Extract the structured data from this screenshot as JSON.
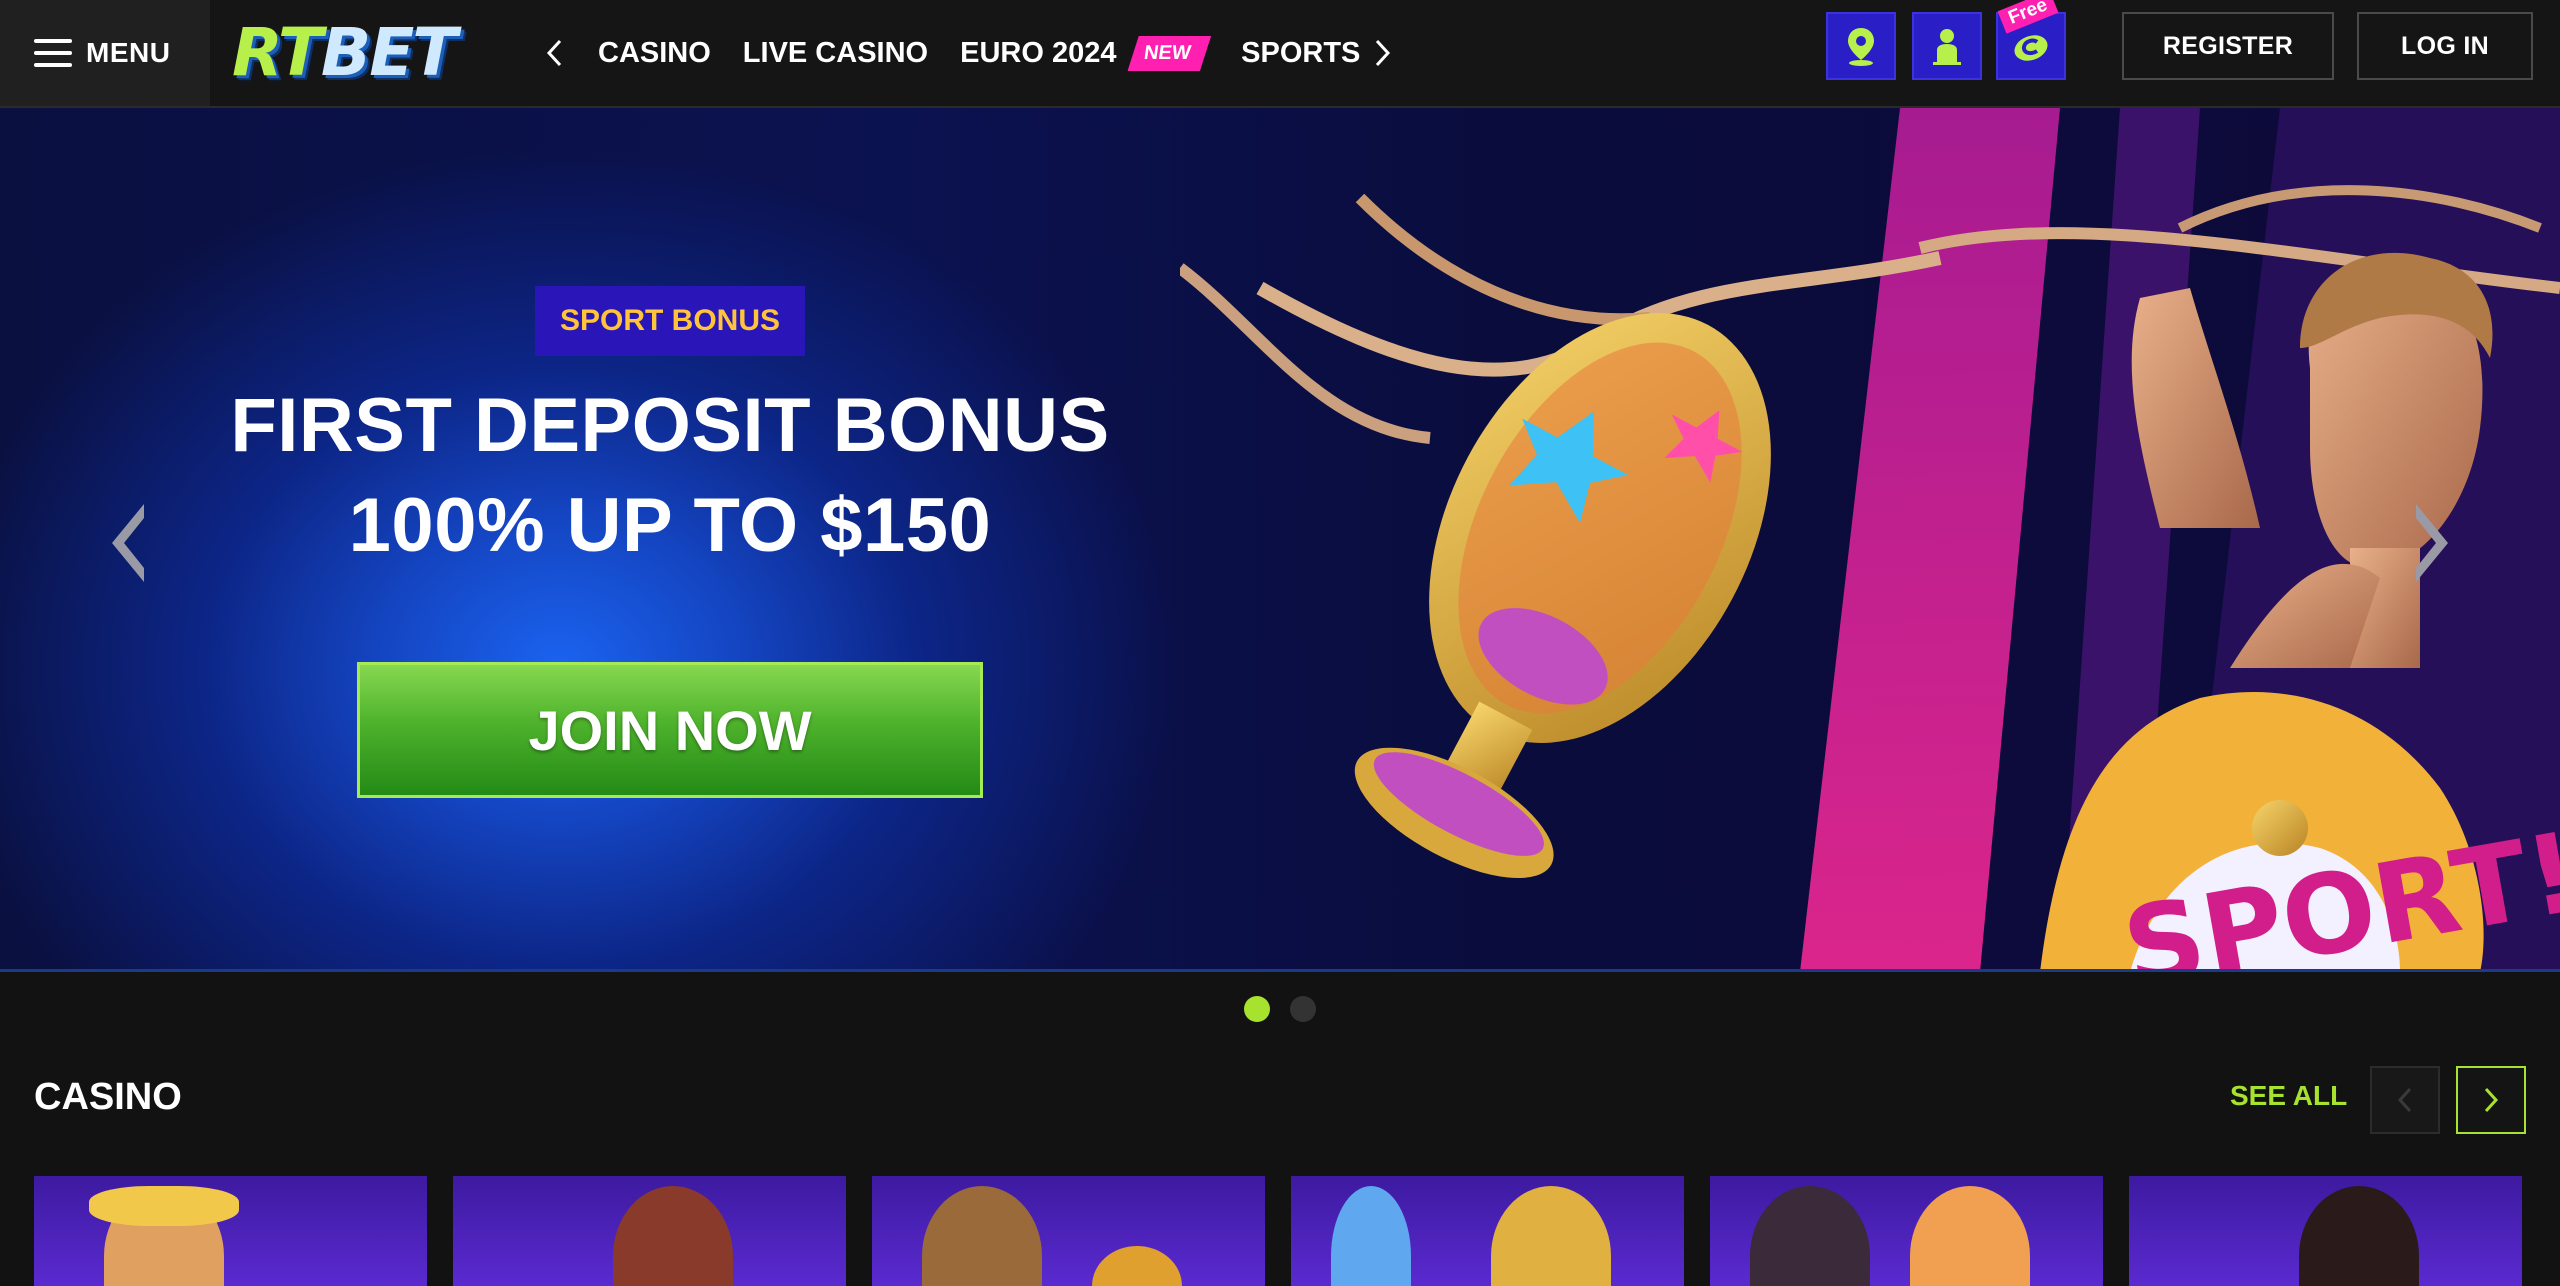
{
  "header": {
    "menu_label": "MENU",
    "logo": {
      "part1": "RT",
      "part2": "BET"
    },
    "nav_items": [
      {
        "label": "CASINO"
      },
      {
        "label": "LIVE CASINO"
      },
      {
        "label": "EURO 2024",
        "badge": "NEW"
      },
      {
        "label": "SPORTS"
      }
    ],
    "icon_buttons": [
      {
        "icon": "location-pin-icon"
      },
      {
        "icon": "user-support-icon"
      },
      {
        "icon": "free-coin-icon",
        "tag": "Free"
      }
    ],
    "register_label": "REGISTER",
    "login_label": "LOG IN"
  },
  "hero": {
    "badge": "SPORT BONUS",
    "headline_line1": "FIRST DEPOSIT BONUS",
    "headline_line2": "100% UP TO $150",
    "cta_label": "JOIN NOW",
    "slides_total": 2,
    "active_slide": 1
  },
  "casino_section": {
    "title": "CASINO",
    "see_all_label": "SEE ALL",
    "games_visible": 6
  },
  "colors": {
    "accent_green": "#a6e22e",
    "brand_blue": "#2a1ec6",
    "badge_pink": "#ff1fb0",
    "bonus_gold": "#ffc43a"
  }
}
